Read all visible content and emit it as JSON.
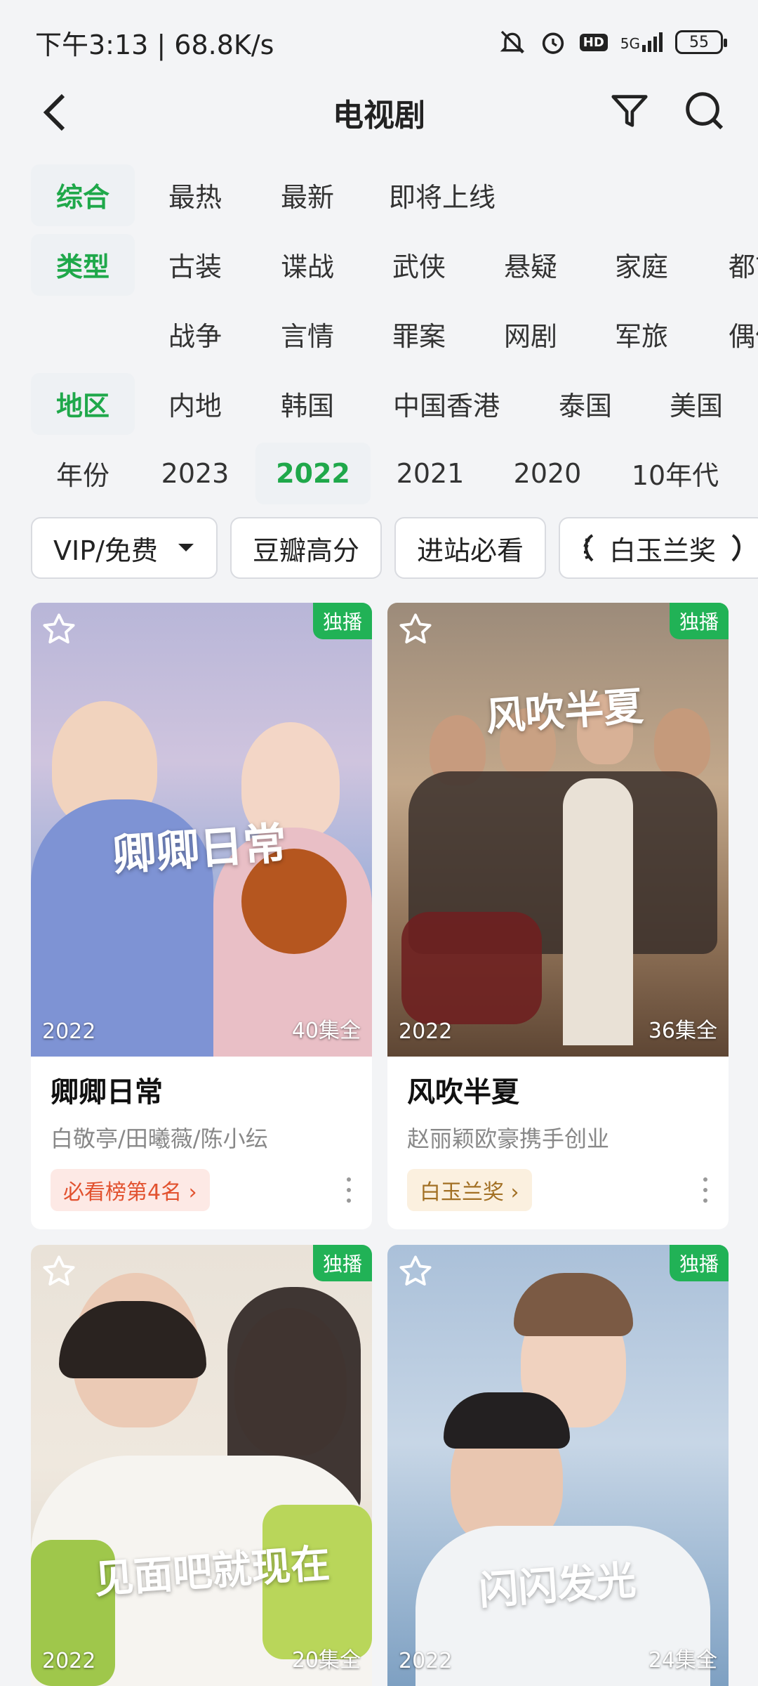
{
  "status": {
    "time_speed": "下午3:13 | 68.8K/s",
    "battery": "55",
    "hd": "HD",
    "net": "5G"
  },
  "header": {
    "title": "电视剧"
  },
  "filters": {
    "row1": {
      "label": "综合",
      "options": [
        "最热",
        "最新",
        "即将上线"
      ]
    },
    "row2": {
      "label": "类型",
      "options": [
        "古装",
        "谍战",
        "武侠",
        "悬疑",
        "家庭",
        "都市"
      ]
    },
    "row3": {
      "options": [
        "战争",
        "言情",
        "罪案",
        "网剧",
        "军旅",
        "偶像"
      ]
    },
    "row4": {
      "label": "地区",
      "options": [
        "内地",
        "韩国",
        "中国香港",
        "泰国",
        "美国"
      ]
    },
    "row5": {
      "label": "年份",
      "options": [
        "2023",
        "2022",
        "2021",
        "2020",
        "10年代"
      ],
      "selected": "2022"
    }
  },
  "tags": [
    "VIP/免费",
    "豆瓣高分",
    "进站必看",
    "白玉兰奖"
  ],
  "cards": [
    {
      "badge": "独播",
      "year": "2022",
      "eps": "40集全",
      "poster_title": "卿卿日常",
      "title": "卿卿日常",
      "desc": "白敬亭/田曦薇/陈小纭",
      "pill": "必看榜第4名 ›"
    },
    {
      "badge": "独播",
      "year": "2022",
      "eps": "36集全",
      "poster_title": "风吹半夏",
      "title": "风吹半夏",
      "desc": "赵丽颖欧豪携手创业",
      "pill": "白玉兰奖 ›"
    },
    {
      "badge": "独播",
      "year": "2022",
      "eps": "20集全",
      "poster_title": "见面吧就现在"
    },
    {
      "badge": "独播",
      "year": "2022",
      "eps": "24集全",
      "poster_title": "闪闪发光"
    }
  ]
}
